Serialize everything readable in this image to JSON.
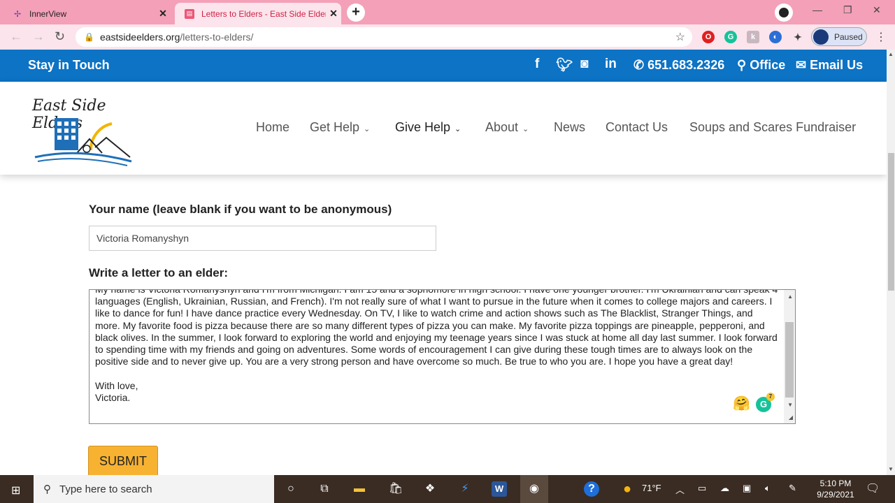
{
  "browser": {
    "tabs": [
      {
        "title": "InnerView",
        "active": false
      },
      {
        "title": "Letters to Elders - East Side Elder",
        "active": true
      }
    ],
    "url_host": "eastsideelders.org",
    "url_path": "/letters-to-elders/",
    "profile_status": "Paused"
  },
  "topbar": {
    "tagline": "Stay in Touch",
    "social": [
      "f",
      "twitter",
      "instagram",
      "in"
    ],
    "phone": "651.683.2326",
    "office": "Office",
    "email": "Email Us"
  },
  "header": {
    "logo_text": "East Side Elders",
    "nav": [
      {
        "label": "Home"
      },
      {
        "label": "Get Help",
        "dropdown": true
      },
      {
        "label": "Give Help",
        "dropdown": true,
        "active": true
      },
      {
        "label": "About",
        "dropdown": true
      },
      {
        "label": "News"
      },
      {
        "label": "Contact Us"
      },
      {
        "label": "Soups and Scares Fundraiser"
      }
    ]
  },
  "form": {
    "name_label": "Your name (leave blank if you want to be anonymous)",
    "name_value": "Victoria Romanyshyn",
    "letter_label": "Write a letter to an elder:",
    "letter_value": "My name is Victoria Romanyshyn and I'm from Michigan. I am 15 and a sophomore in high school. I have one younger brother. I'm Ukrainian and can speak 4 languages (English, Ukrainian, Russian, and French). I'm not really sure of what I want to pursue in the future when it comes to college majors and careers. I like to dance for fun! I have dance practice every Wednesday. On TV, I like to watch crime and action shows such as The Blacklist, Stranger Things, and more. My favorite food is pizza because there are so many different types of pizza you can make. My favorite pizza toppings are pineapple, pepperoni, and black olives. In the summer, I look forward to exploring the world and enjoying my teenage years since I was stuck at home all day last summer. I look forward to spending time with my friends and going on adventures. Some words of encouragement I can give during these tough times are to always look on the positive side and to never give up. You are a very strong person and have overcome so much. Be true to who you are. I hope you have a great day!\n\nWith love,\nVictoria.",
    "grammarly_count": "7",
    "submit_label": "SUBMIT"
  },
  "taskbar": {
    "search_placeholder": "Type here to search",
    "weather": "71°F",
    "time": "5:10 PM",
    "date": "9/29/2021"
  },
  "colors": {
    "brand_blue": "#0c73c5",
    "submit_orange": "#f7b232",
    "chrome_pink": "#f3a0b8"
  }
}
